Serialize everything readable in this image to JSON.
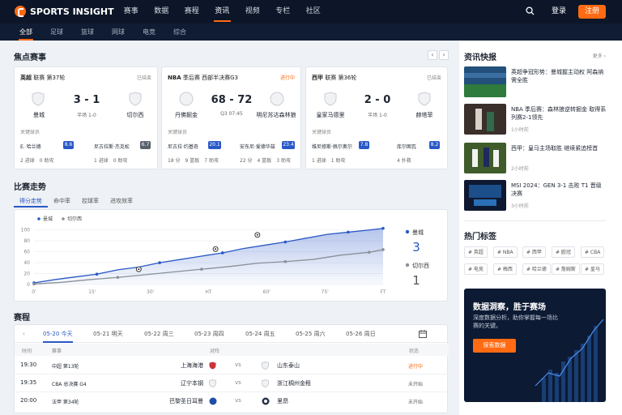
{
  "brand": "SPORTS INSIGHT",
  "nav": [
    "赛事",
    "数据",
    "赛程",
    "资讯",
    "视频",
    "专栏",
    "社区"
  ],
  "nav_active": 3,
  "login": "登录",
  "register": "注册",
  "subnav": [
    "全部",
    "足球",
    "篮球",
    "网球",
    "电竞",
    "综合"
  ],
  "featured": {
    "title": "焦点赛事",
    "prev": "‹",
    "next": "›",
    "matches": [
      {
        "league": "英超",
        "round": "联赛 第37轮",
        "state": "已结束",
        "live": false,
        "home": "曼城",
        "away": "切尔西",
        "score": "3 - 1",
        "sub": "半场 1-0",
        "kp_label": "关键球员",
        "p1": "E. 哈兰德",
        "p1_rating": "8.6",
        "p1_stats": "2 进球　0 助攻",
        "p2": "尼古拉斯·杰克松",
        "p2_rating": "6.7",
        "p2_stats": "1 进球　0 助攻",
        "p2_gray": true
      },
      {
        "league": "NBA",
        "round": "季后赛 西部半决赛G3",
        "state": "进行中",
        "live": true,
        "home": "丹佛掘金",
        "away": "明尼苏达森林狼",
        "score": "68 - 72",
        "sub": "Q3 07:45",
        "kp_label": "关键球员",
        "p1": "尼古拉·约基奇",
        "p1_rating": "20.1",
        "p1_stats": "18 分　9 篮板　7 助攻",
        "p2": "安东尼·爱德华兹",
        "p2_rating": "23.4",
        "p2_stats": "22 分　4 篮板　3 助攻",
        "p2_gray": false
      },
      {
        "league": "西甲",
        "round": "联赛 第36轮",
        "state": "已结束",
        "live": false,
        "home": "皇家马德里",
        "away": "赫塔菲",
        "score": "2 - 0",
        "sub": "半场 1-0",
        "kp_label": "关键球员",
        "p1": "维尼修斯·佩尔奥尔",
        "p1_rating": "7.8",
        "p1_stats": "1 进球　1 助攻",
        "p2": "库尔图瓦",
        "p2_rating": "8.2",
        "p2_stats": "4 扑救",
        "p2_gray": false
      }
    ]
  },
  "trend": {
    "title": "比赛走势",
    "tabs": [
      "得分走势",
      "命中率",
      "控球率",
      "进攻效率"
    ],
    "home_name": "曼城",
    "away_name": "切尔西",
    "home_score": "3",
    "away_score": "1"
  },
  "chart_data": {
    "type": "line",
    "x_ticks": [
      "0'",
      "15'",
      "30'",
      "HT",
      "60'",
      "75'",
      "FT"
    ],
    "y_ticks": [
      0,
      20,
      40,
      60,
      80,
      100
    ],
    "ylim": [
      0,
      110
    ],
    "legend": "top-left",
    "series": [
      {
        "name": "曼城",
        "color": "#2958c7",
        "values": [
          [
            0,
            3
          ],
          [
            3,
            9
          ],
          [
            6,
            14
          ],
          [
            9,
            19
          ],
          [
            12,
            27
          ],
          [
            15,
            32
          ],
          [
            18,
            40
          ],
          [
            21,
            46
          ],
          [
            24,
            52
          ],
          [
            27,
            58
          ],
          [
            30,
            66
          ],
          [
            33,
            72
          ],
          [
            36,
            78
          ],
          [
            39,
            85
          ],
          [
            42,
            92
          ],
          [
            45,
            96
          ],
          [
            48,
            100
          ],
          [
            50,
            103
          ]
        ]
      },
      {
        "name": "切尔西",
        "color": "#8a9099",
        "values": [
          [
            0,
            1
          ],
          [
            4,
            4
          ],
          [
            8,
            9
          ],
          [
            12,
            13
          ],
          [
            16,
            18
          ],
          [
            20,
            23
          ],
          [
            24,
            28
          ],
          [
            28,
            33
          ],
          [
            32,
            39
          ],
          [
            36,
            42
          ],
          [
            40,
            46
          ],
          [
            44,
            54
          ],
          [
            48,
            59
          ],
          [
            50,
            64
          ]
        ]
      }
    ],
    "events": [
      [
        15,
        28
      ],
      [
        26,
        65
      ],
      [
        32,
        91
      ]
    ]
  },
  "schedule": {
    "title": "赛程",
    "dates": [
      "05-20 今天",
      "05-21 明天",
      "05-22 周三",
      "05-23 周四",
      "05-24 周五",
      "05-25 周六",
      "05-26 周日"
    ],
    "head": {
      "time": "时间",
      "event": "赛事",
      "match": "对阵",
      "status": "状态"
    },
    "rows": [
      {
        "time": "19:30",
        "event": "中超 第13轮",
        "home": "上海海港",
        "vs": "vs",
        "away": "山东泰山",
        "status": "进行中",
        "live": true
      },
      {
        "time": "19:35",
        "event": "CBA 总决赛 G4",
        "home": "辽宁本钢",
        "vs": "vs",
        "away": "浙江稠州金租",
        "status": "未开始",
        "live": false
      },
      {
        "time": "20:00",
        "event": "法甲 第34轮",
        "home": "巴黎圣日耳曼",
        "vs": "vs",
        "away": "里昂",
        "status": "未开始",
        "live": false
      }
    ]
  },
  "news": {
    "title": "资讯快报",
    "more": "更多 ›",
    "items": [
      {
        "title": "英超争冠形势：曼城握主动权 阿森纳需全胜",
        "time": ""
      },
      {
        "title": "NBA 季后赛：森林狼逆转掘金 取得系列赛2-1领先",
        "time": "1小时前"
      },
      {
        "title": "西甲：皇马主场取胜 继续紧追榜首",
        "time": "2小时前"
      },
      {
        "title": "MSI 2024：GEN 3-1 击败 T1 晋级决赛",
        "time": "3小时前"
      }
    ]
  },
  "tags": {
    "title": "热门标签",
    "items": [
      "# 英超",
      "# NBA",
      "# 西甲",
      "# 欧冠",
      "# CBA",
      "# 电竞",
      "# 梅西",
      "# 哈兰德",
      "# 詹姆斯",
      "# 皇马"
    ]
  },
  "promo": {
    "title": "数据洞察，胜于赛场",
    "text": "深度数据分析，助你掌握每一场比赛的关键。",
    "button": "探索数据"
  }
}
